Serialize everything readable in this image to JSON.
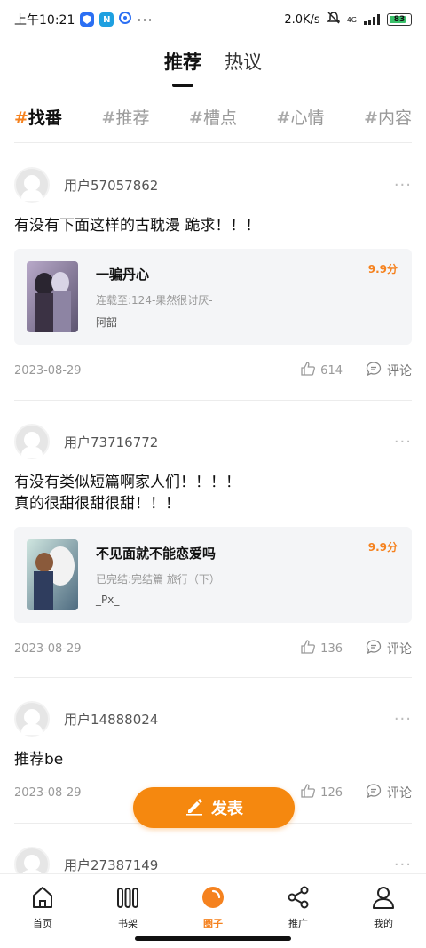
{
  "status_bar": {
    "time": "上午10:21",
    "app_n_letter": "N",
    "dots": "···",
    "net_speed": "2.0K/s",
    "network_type": "4G",
    "battery": "83"
  },
  "top_tabs": [
    {
      "label": "推荐",
      "active": true
    },
    {
      "label": "热议",
      "active": false
    }
  ],
  "hash_tabs": [
    {
      "label": "找番",
      "active": true
    },
    {
      "label": "推荐",
      "active": false
    },
    {
      "label": "槽点",
      "active": false
    },
    {
      "label": "心情",
      "active": false
    },
    {
      "label": "内容",
      "active": false
    }
  ],
  "hash_symbol": "#",
  "posts": [
    {
      "username": "用户57057862",
      "text": "有没有下面这样的古耽漫 跪求！！！",
      "book": {
        "title": "一骗丹心",
        "status": "连载至:124-果然很讨厌-",
        "author": "阿韶",
        "score": "9.9分"
      },
      "date": "2023-08-29",
      "likes": "614",
      "comment_label": "评论"
    },
    {
      "username": "用户73716772",
      "text_lines": [
        "有没有类似短篇啊家人们！！！！",
        "真的很甜很甜很甜！！！"
      ],
      "book": {
        "title": "不见面就不能恋爱吗",
        "status": "已完结:完结篇 旅行（下）",
        "author": "_Px_",
        "score": "9.9分"
      },
      "date": "2023-08-29",
      "likes": "136",
      "comment_label": "评论"
    },
    {
      "username": "用户14888024",
      "text": "推荐be",
      "date": "2023-08-29",
      "likes": "126",
      "comment_label": "评论"
    },
    {
      "username": "用户27387149"
    }
  ],
  "more_glyph": "···",
  "publish_label": "发表",
  "bottom_nav": [
    {
      "label": "首页",
      "icon": "home-icon",
      "active": false
    },
    {
      "label": "书架",
      "icon": "bookshelf-icon",
      "active": false
    },
    {
      "label": "圈子",
      "icon": "circle-icon",
      "active": true
    },
    {
      "label": "推广",
      "icon": "share-icon",
      "active": false
    },
    {
      "label": "我的",
      "icon": "profile-icon",
      "active": false
    }
  ],
  "colors": {
    "accent": "#f5821f",
    "publish_bg": "#f5880f",
    "card_bg": "#f4f5f7",
    "muted_text": "#999999"
  }
}
